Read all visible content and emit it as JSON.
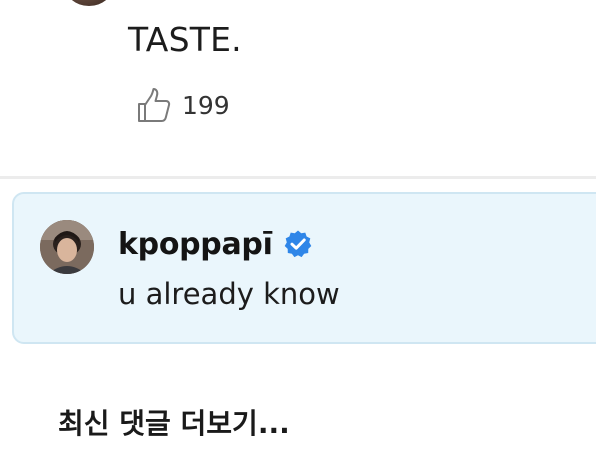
{
  "comment": {
    "text": "TASTE.",
    "likes": "199",
    "like_icon": "thumbs-up-icon"
  },
  "reply": {
    "author": "kpoppapī",
    "verified_icon": "verified-badge-icon",
    "text": "u already know",
    "colors": {
      "card_background": "#eaf6fc",
      "card_border": "#cfe6f2",
      "verified_badge": "#2f86e8"
    }
  },
  "more_comments_label": "최신 댓글 더보기..."
}
